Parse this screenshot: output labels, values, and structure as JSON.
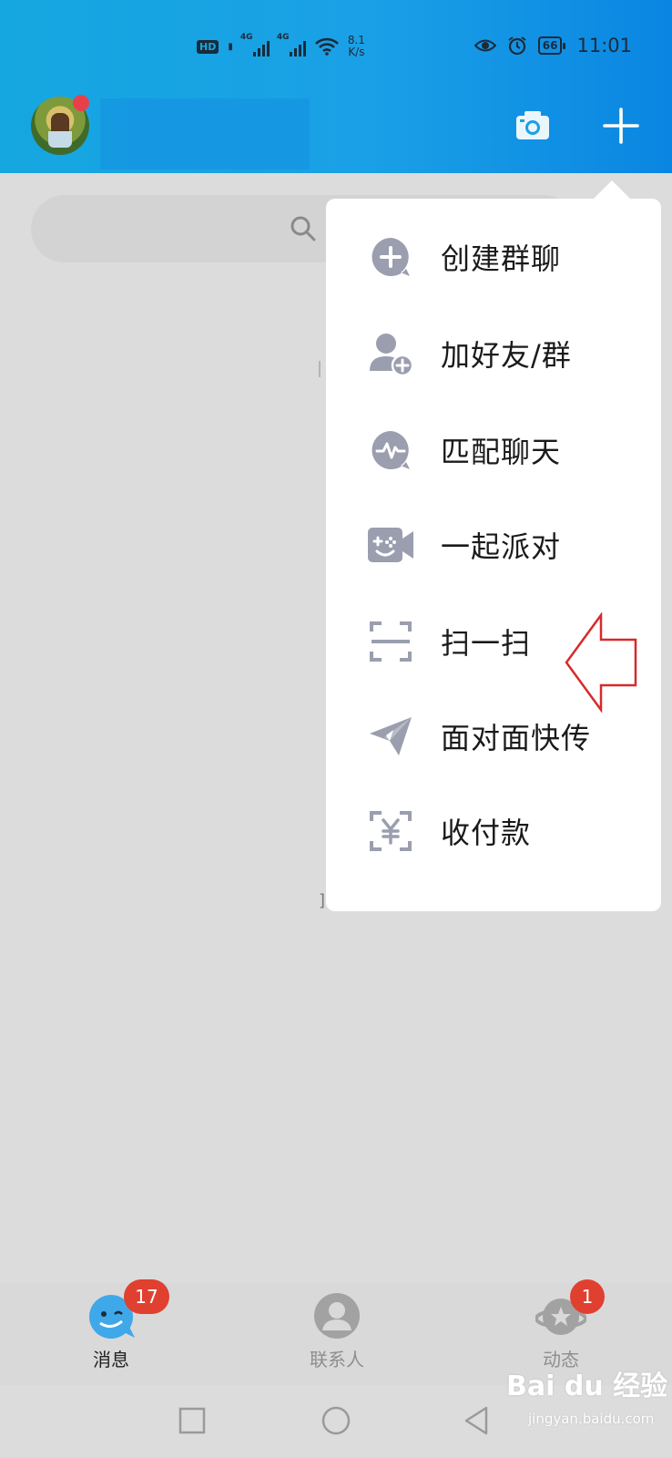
{
  "status_bar": {
    "hd_label": "HD",
    "network_1": "4G",
    "network_2": "4G",
    "speed_value": "8.1",
    "speed_unit": "K/s",
    "battery": "66",
    "time": "11:01"
  },
  "header": {
    "camera_icon": "camera-icon",
    "add_icon": "plus-icon"
  },
  "menu": {
    "items": [
      {
        "label": "创建群聊",
        "icon": "create-group-icon"
      },
      {
        "label": "加好友/群",
        "icon": "add-friend-icon"
      },
      {
        "label": "匹配聊天",
        "icon": "match-chat-icon"
      },
      {
        "label": "一起派对",
        "icon": "party-icon"
      },
      {
        "label": "扫一扫",
        "icon": "scan-icon"
      },
      {
        "label": "面对面快传",
        "icon": "face-transfer-icon"
      },
      {
        "label": "收付款",
        "icon": "payment-icon"
      }
    ]
  },
  "tabbar": {
    "tabs": [
      {
        "label": "消息",
        "badge": "17",
        "active": true
      },
      {
        "label": "联系人",
        "badge": "",
        "active": false
      },
      {
        "label": "动态",
        "badge": "1",
        "active": false
      }
    ]
  },
  "watermark": {
    "text": "Bai du 经验",
    "sub": "jingyan.baidu.com"
  },
  "colors": {
    "header_blue": "#15a7e0",
    "badge_red": "#e0402f",
    "icon_gray": "#9a9eae",
    "arrow_red": "#d62a2a"
  }
}
